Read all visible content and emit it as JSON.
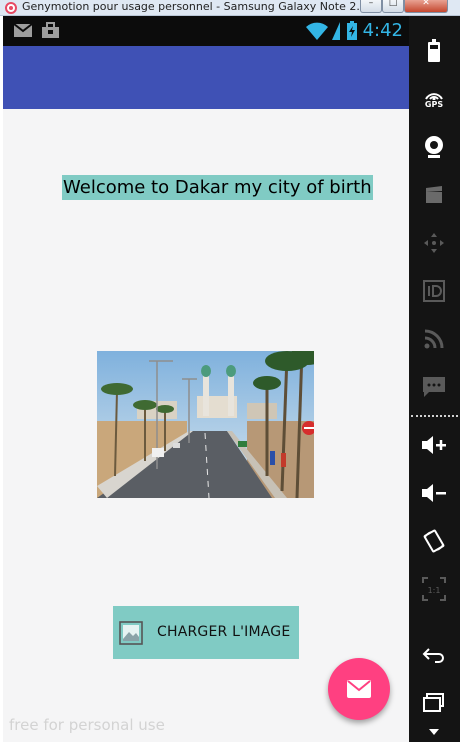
{
  "window": {
    "title": "Genymotion pour usage personnel - Samsung Galaxy Note 2...",
    "buttons": {
      "minimize": "–",
      "maximize": "□",
      "close": "✕"
    }
  },
  "statusbar": {
    "time": "4:42",
    "left_icons": [
      "gmail-icon",
      "bag-notification-icon"
    ],
    "right_icons": [
      "wifi-icon",
      "sim-icon",
      "battery-icon"
    ],
    "time_color": "#33b5e5"
  },
  "appbar": {
    "color": "#3f51b5"
  },
  "main": {
    "welcome_text": "Welcome to Dakar my city of birth",
    "photo_icon": "dakar-corniche-photo",
    "charger_label": "CHARGER L'IMAGE",
    "charger_icon": "image-icon",
    "fab_icon": "mail-icon",
    "accent_color": "#80cbc4",
    "fab_color": "#ff4081"
  },
  "watermark": "free for personal use",
  "sidebar": {
    "tools": [
      "battery-tool-icon",
      "gps-icon",
      "webcam-icon",
      "video-clapper-icon",
      "dpad-icon",
      "id-icon",
      "rss-icon",
      "sms-icon",
      "volume-up-icon",
      "volume-down-icon",
      "rotate-icon",
      "pixel-perfect-icon",
      "back-icon",
      "recent-apps-icon"
    ],
    "gps_label": "GPS"
  }
}
